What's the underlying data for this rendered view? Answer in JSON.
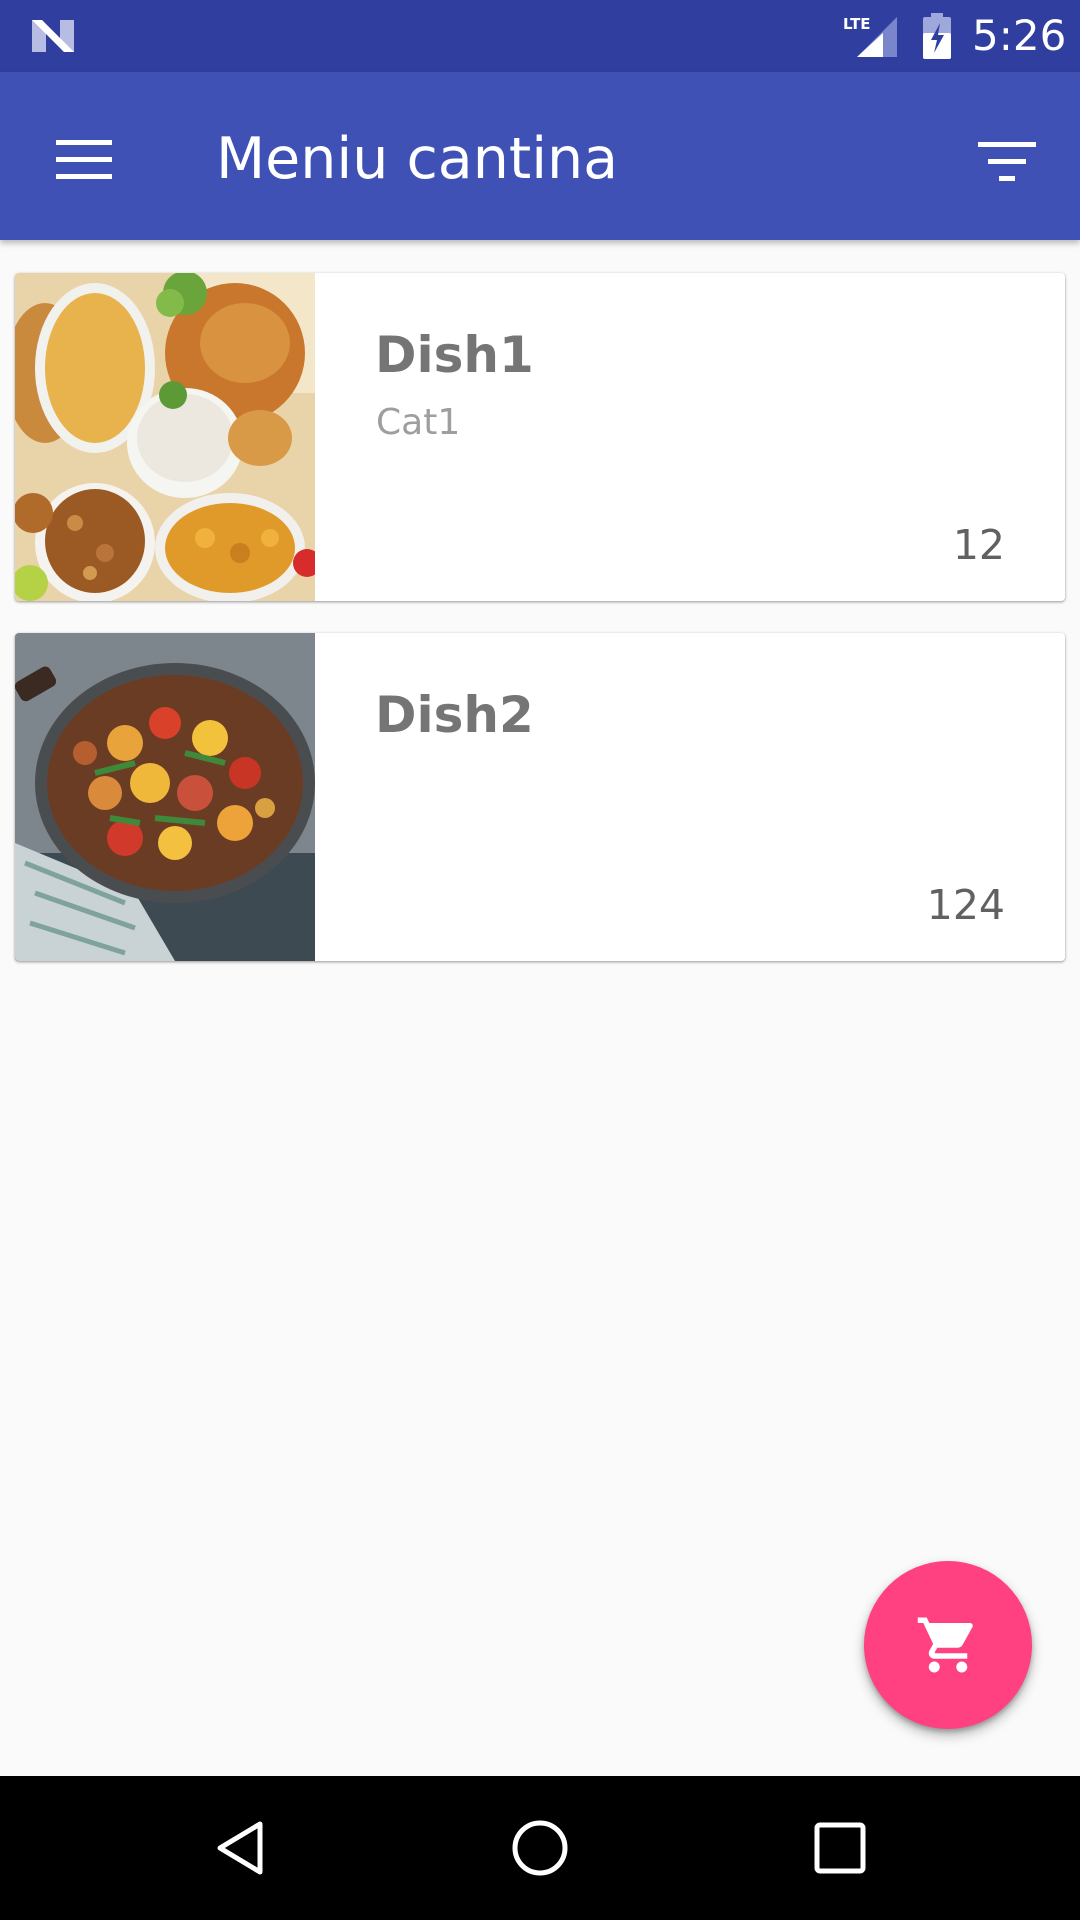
{
  "status_bar": {
    "time": "5:26",
    "network_label": "LTE",
    "icons": [
      "notification-n-icon",
      "lte-signal-icon",
      "battery-charging-icon"
    ]
  },
  "app_bar": {
    "title": "Meniu cantina",
    "menu_icon": "hamburger-menu-icon",
    "filter_icon": "filter-icon",
    "background_color": "#3f51b5",
    "status_color": "#303f9f"
  },
  "dishes": [
    {
      "name": "Dish1",
      "category": "Cat1",
      "price": "12",
      "image": "holiday-feast-photo"
    },
    {
      "name": "Dish2",
      "category": "",
      "price": "124",
      "image": "chicken-stir-fry-photo"
    }
  ],
  "fab": {
    "icon": "shopping-cart-icon",
    "color": "#ff4081"
  },
  "nav_bar": {
    "icons": [
      "back-triangle-icon",
      "home-circle-icon",
      "recents-square-icon"
    ]
  }
}
